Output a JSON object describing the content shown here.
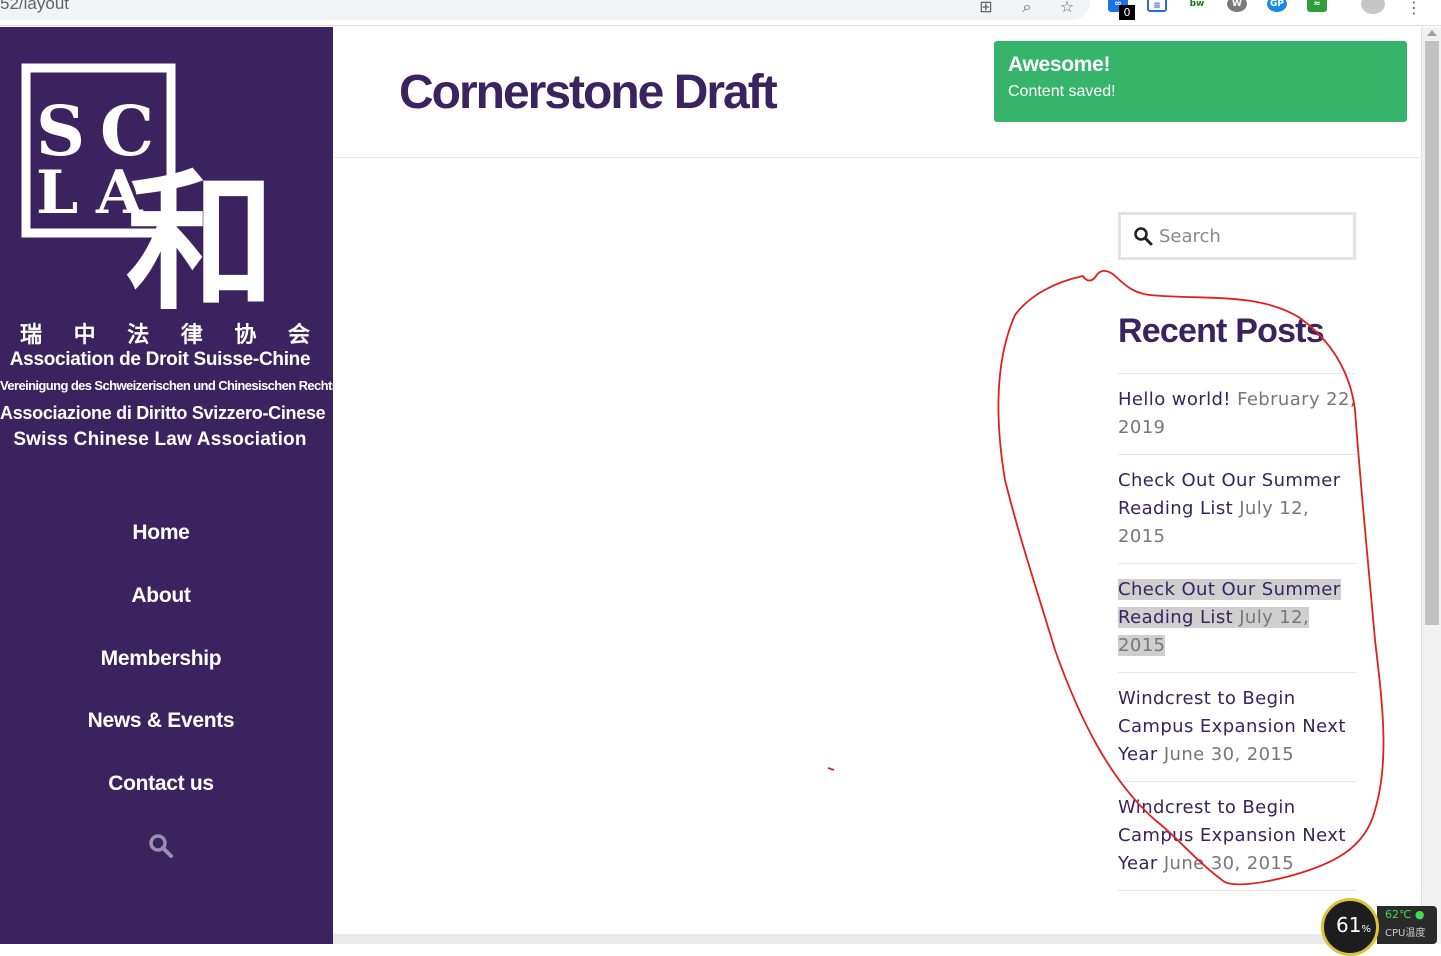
{
  "browser": {
    "url_fragment": "52/layout",
    "extension_badge": "0",
    "ext_gp_label": "GP",
    "ext_bw_label": "bw"
  },
  "sidebar": {
    "logo_letters": [
      "S",
      "C",
      "L",
      "A"
    ],
    "logo_mark": "和",
    "chinese_name": [
      "瑞",
      "中",
      "法",
      "律",
      "协",
      "会"
    ],
    "association_names": [
      "Association de Droit Suisse-Chine",
      "Vereinigung des Schweizerischen und Chinesischen Rechts",
      "Associazione di Diritto Svizzero-Cinese",
      "Swiss Chinese Law Association"
    ],
    "nav": [
      "Home",
      "About",
      "Membership",
      "News & Events",
      "Contact us"
    ],
    "search_icon": "search-icon"
  },
  "main": {
    "page_title": "Cornerstone Draft",
    "notice": {
      "title": "Awesome!",
      "message": "Content saved!"
    },
    "search": {
      "placeholder": "Search"
    },
    "recent_posts": {
      "title": "Recent Posts",
      "items": [
        {
          "title": "Hello world!",
          "date": "February 22, 2019"
        },
        {
          "title": "Check Out Our Summer Reading List",
          "date": "July 12, 2015"
        },
        {
          "title": "Check Out Our Summer Reading List",
          "date": "July 12, 2015"
        },
        {
          "title": "Windcrest to Begin Campus Expansion Next Year",
          "date": "June 30, 2015"
        },
        {
          "title": "Windcrest to Begin Campus Expansion Next Year",
          "date": "June 30, 2015"
        }
      ]
    }
  },
  "cpu_widget": {
    "percent": "61",
    "percent_sign": "%",
    "temperature": "62℃",
    "label": "CPU温度"
  },
  "colors": {
    "sidebar": "#3a235e",
    "accent_purple": "#3a235e",
    "notice_green": "#35b46a",
    "annotation_red": "#e02020"
  }
}
